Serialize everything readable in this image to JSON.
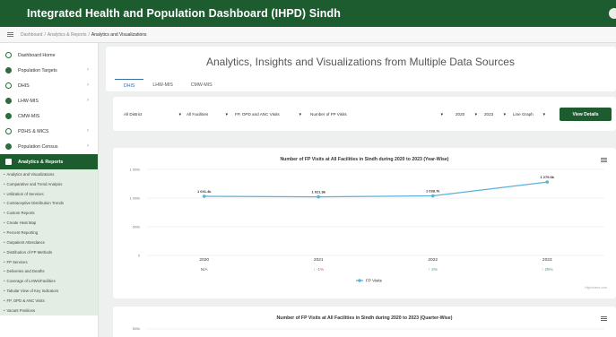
{
  "app": {
    "title": "Integrated Health and Population Dashboard (IHPD) Sindh"
  },
  "breadcrumb": [
    "Dashboard",
    "Analytics & Reports",
    "Analytics and Visualizations"
  ],
  "sidebar": {
    "items": [
      {
        "label": "Dashboard Home",
        "icon": "home-icon",
        "arrow": ""
      },
      {
        "label": "Population Targets",
        "icon": "target-icon",
        "arrow": "›"
      },
      {
        "label": "DHIS",
        "icon": "dhis-icon",
        "arrow": "›"
      },
      {
        "label": "LHW-MIS",
        "icon": "lhw-icon",
        "arrow": "›"
      },
      {
        "label": "CMW-MIS",
        "icon": "cmw-icon",
        "arrow": ""
      },
      {
        "label": "PDHS & MICS",
        "icon": "survey-icon",
        "arrow": "›"
      },
      {
        "label": "Population Census",
        "icon": "census-icon",
        "arrow": "›"
      },
      {
        "label": "Analytics & Reports",
        "icon": "reports-icon",
        "arrow": ""
      }
    ],
    "sub_items": [
      "Analytics and Visualizations",
      "Comparative and Trend Analysis",
      "Utilization of Services",
      "Contraceptive Distribution Trends",
      "Custom Reports",
      "Create Heat Map",
      "Percent Reporting",
      "Outpatient Attendance",
      "Distribution of FP Methods",
      "FP Services",
      "Deliveries and Deaths",
      "Coverage of LHWs/Facilities",
      "Tabular View of Key Indicators",
      "FP, OPD & ANC Visits",
      "Vacant Positions"
    ]
  },
  "main": {
    "title": "Analytics, Insights and Visualizations from Multiple Data Sources",
    "tabs": [
      "DHIS",
      "LHW-MIS",
      "CMW-MIS"
    ],
    "active_tab": "DHIS"
  },
  "filters": {
    "district": "All District",
    "facility": "All Facilities",
    "visit_type": "FP, OPD and ANC Visits",
    "indicator": "Number of FP Visits",
    "year_from": "2020",
    "year_to": "2023",
    "chart_type": "Line Graph",
    "caret": "▼",
    "button": "View Details"
  },
  "chart": {
    "title": "Number of FP Visits at All Facilities in Sindh during 2020 to 2023 (Year-Wise)",
    "change": [
      "N/A",
      "↓ -1%",
      "↑ 2%",
      "↑ 25%"
    ],
    "change_colors": [
      "#555555",
      "#e05050",
      "#3aa56a",
      "#3aa56a"
    ],
    "credit": "Highcharts.com",
    "line_color": "#5bb0dd"
  },
  "chart2": {
    "title": "Number of FP Visits at All Facilities in Sindh during 2020 to 2023 (Quarter-Wise)",
    "ytick": "500k"
  },
  "chart_data": {
    "type": "line",
    "categories": [
      "2020",
      "2021",
      "2022",
      "2023"
    ],
    "series": [
      {
        "name": "FP Visits",
        "values": [
          1031400,
          1021800,
          1038700,
          1279600
        ]
      }
    ],
    "data_labels": [
      "1 031.4k",
      "1 021.8k",
      "1 038.7k",
      "1 279.6k"
    ],
    "yticks": [
      "0",
      "500k",
      "1 000k",
      "1 500k"
    ],
    "ylim": [
      0,
      1500000
    ],
    "grid": true,
    "legend": "bottom"
  }
}
